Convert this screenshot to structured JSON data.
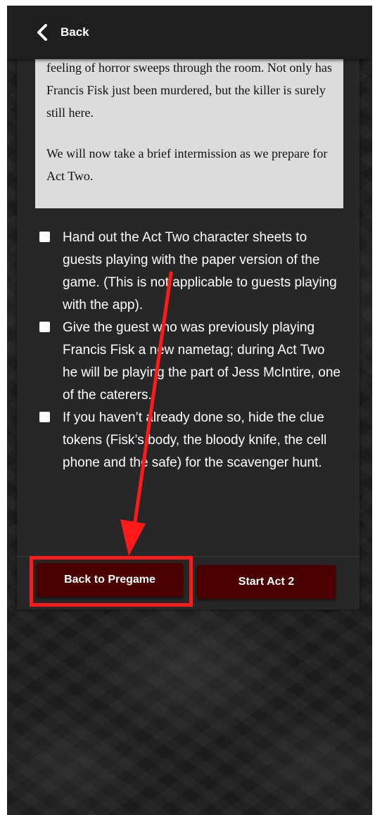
{
  "header": {
    "back_label": "Back"
  },
  "story": {
    "paragraphs": [
      "feeling of horror sweeps through the room. Not only has Francis Fisk just been murdered, but the killer is surely still here.",
      "We will now take a brief intermission as we prepare for Act Two."
    ]
  },
  "tasks": [
    {
      "text": "Hand out the Act Two character sheets to guests playing with the paper version of the game. (This is not applicable to guests playing with the app).",
      "checked": false
    },
    {
      "text": "Give the guest who was previously playing Francis Fisk a new nametag; during Act Two he will be playing the part of Jess McIntire, one of the caterers.",
      "checked": false
    },
    {
      "text": "If you haven’t already done so, hide the clue tokens (Fisk’s body, the bloody knife, the cell phone and the safe) for the scavenger hunt.",
      "checked": false
    }
  ],
  "buttons": {
    "back_to_pregame": "Back to Pregame",
    "start_act2": "Start Act 2"
  },
  "annotation": {
    "color": "#ff1a1a",
    "icon": "arrow-annotation"
  },
  "colors": {
    "button_bg": "#4a0000",
    "panel_bg": "#272727",
    "story_bg": "#dcdcdc"
  }
}
